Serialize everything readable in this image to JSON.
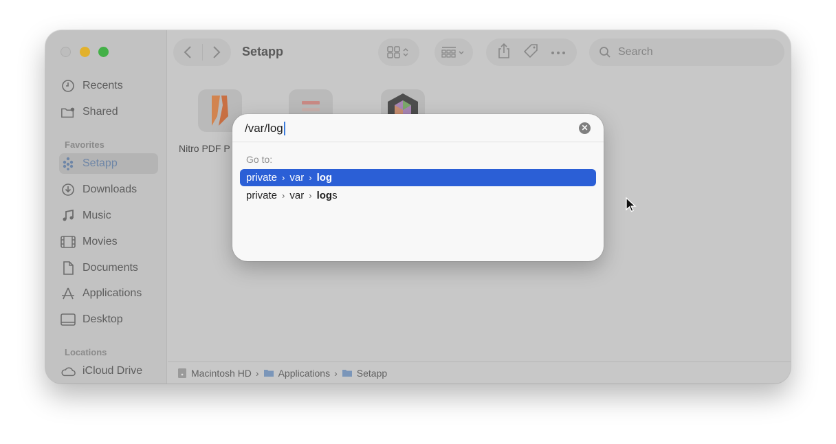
{
  "window": {
    "title": "Setapp"
  },
  "sidebar": {
    "items_top": [
      {
        "label": "Recents",
        "icon": "clock-icon"
      },
      {
        "label": "Shared",
        "icon": "shared-folder-icon"
      }
    ],
    "favorites_header": "Favorites",
    "favorites": [
      {
        "label": "Setapp",
        "icon": "setapp-icon",
        "active": true
      },
      {
        "label": "Downloads",
        "icon": "download-icon"
      },
      {
        "label": "Music",
        "icon": "music-icon"
      },
      {
        "label": "Movies",
        "icon": "film-icon"
      },
      {
        "label": "Documents",
        "icon": "document-icon"
      },
      {
        "label": "Applications",
        "icon": "applications-icon"
      },
      {
        "label": "Desktop",
        "icon": "desktop-icon"
      }
    ],
    "locations_header": "Locations",
    "locations": [
      {
        "label": "iCloud Drive",
        "icon": "cloud-icon"
      }
    ]
  },
  "toolbar": {
    "search_placeholder": "Search"
  },
  "content": {
    "file_label": "Nitro PDF P"
  },
  "pathbar": {
    "segments": [
      "Macintosh HD",
      "Applications",
      "Setapp"
    ]
  },
  "goto_dialog": {
    "input_value": "/var/log",
    "goto_label": "Go to:",
    "suggestions": [
      {
        "parts": [
          "private",
          "var"
        ],
        "match": "log",
        "suffix": ""
      },
      {
        "parts": [
          "private",
          "var"
        ],
        "match": "log",
        "suffix": "s"
      }
    ],
    "chevron": "›",
    "selected_color": "#2b5fd6"
  }
}
